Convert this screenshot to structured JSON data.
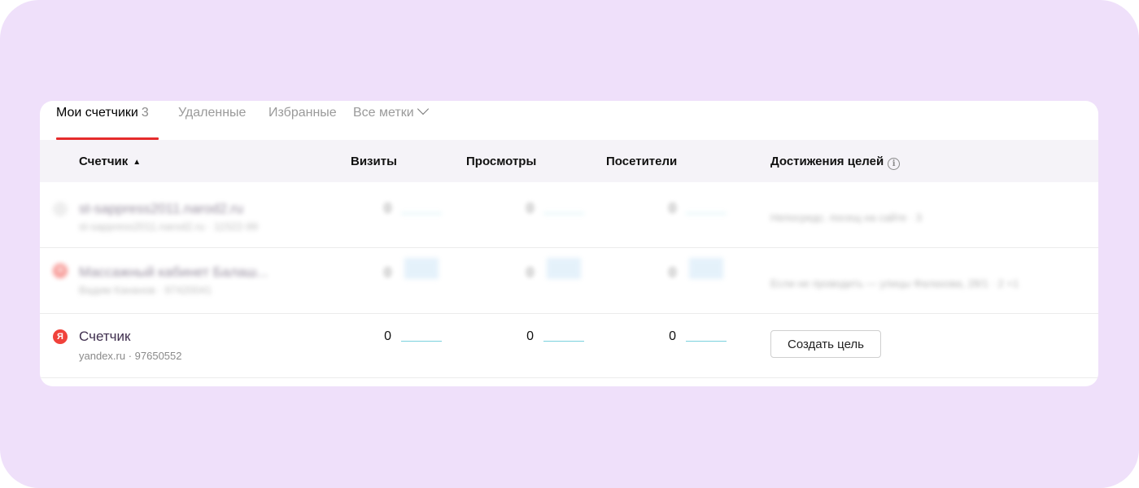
{
  "tabs": [
    {
      "label": "Мои счетчики",
      "count": "3"
    },
    {
      "label": "Удаленные"
    },
    {
      "label": "Избранные"
    },
    {
      "label": "Все метки"
    }
  ],
  "table": {
    "columns": {
      "counter": "Счетчик",
      "visits": "Визиты",
      "views": "Просмотры",
      "visitors": "Посетители",
      "goals": "Достижения целей"
    },
    "sort_indicator": "▲",
    "rows": [
      {
        "name": "st-sappress2011.narod2.ru",
        "sub": "st-sappress2011.narod2.ru · 11522-99",
        "visits": "0",
        "views": "0",
        "visitors": "0",
        "goals_text": "Непосредс. посещ на сайте · 3",
        "icon": "grey-circle-icon",
        "blurred": true
      },
      {
        "name": "Массажный кабинет Балаш...",
        "sub": "Вадим Кананов · 97420041",
        "visits": "0",
        "views": "0",
        "visitors": "0",
        "goals_text": "Если не проводить — улицы Фалахова, 28/1 · 2 +1",
        "icon": "yandex-icon",
        "blurred": true
      },
      {
        "name": "Счетчик",
        "sub": "yandex.ru · 97650552",
        "visits": "0",
        "views": "0",
        "visitors": "0",
        "goal_button": "Создать цель",
        "icon": "yandex-icon",
        "blurred": false
      }
    ]
  },
  "icons": {
    "yandex_letter": "Я",
    "info": "i",
    "dropdown": "chevron-down-icon"
  },
  "colors": {
    "background": "#efe0fa",
    "accent_underline": "#e52b2b",
    "sparkline": "#7ad1de",
    "yandex_red": "#f0423b"
  }
}
